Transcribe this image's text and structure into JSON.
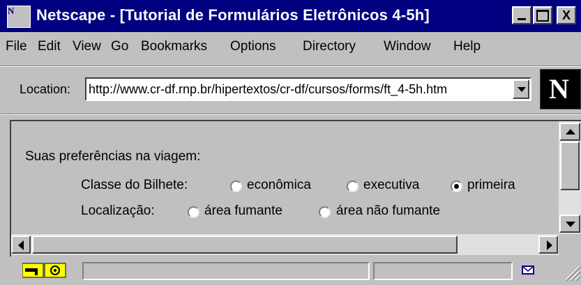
{
  "window": {
    "title": "Netscape - [Tutorial de Formulários Eletrônicos 4-5h]",
    "app_icon_text": "N",
    "buttons": {
      "minimize": "minimize",
      "maximize": "maximize",
      "close": "X"
    }
  },
  "menu": [
    "File",
    "Edit",
    "View",
    "Go",
    "Bookmarks",
    "Options",
    "Directory",
    "Window",
    "Help"
  ],
  "location": {
    "label": "Location:",
    "url": "http://www.cr-df.rnp.br/hipertextos/cr-df/cursos/forms/ft_4-5h.htm"
  },
  "logo": {
    "letter": "N"
  },
  "content": {
    "heading": "Suas preferências na viagem:",
    "ticket_class": {
      "label": "Classe do Bilhete:",
      "options": [
        "econômica",
        "executiva",
        "primeira"
      ],
      "selected": "primeira"
    },
    "location_pref": {
      "label": "Localização:",
      "options": [
        "área fumante",
        "área não fumante"
      ],
      "selected": null
    }
  },
  "icons": {
    "security": "key-lock-icon",
    "mail": "mail-envelope-icon",
    "resize": "resize-grip-icon"
  },
  "colors": {
    "titlebar": "#000080",
    "chrome": "#c0c0c0",
    "logo_bg": "#000000"
  }
}
